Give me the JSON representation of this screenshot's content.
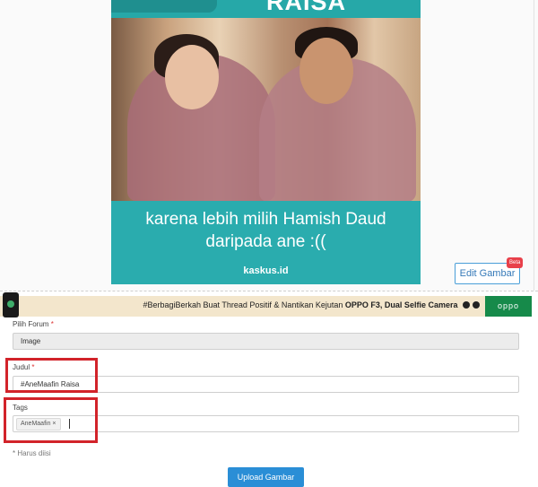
{
  "meme": {
    "title": "RAISA",
    "caption_line1": "karena lebih milih Hamish Daud",
    "caption_line2": "daripada ane :((",
    "brand": "kaskus.id"
  },
  "edit_image": {
    "label": "Edit Gambar",
    "badge": "Beta"
  },
  "banner": {
    "text": "#BerbagiBerkah Buat Thread Positif & Nantikan Kejutan ",
    "text_bold": "OPPO F3, Dual Selfie Camera",
    "logo": "oppo"
  },
  "form": {
    "forum_label": "Pilih Forum",
    "forum_value": "Image",
    "title_label": "Judul",
    "title_value": "#AneMaafin Raisa",
    "tags_label": "Tags",
    "tag_value": "AneMaafin",
    "tag_remove": "×",
    "required_asterisk": "*",
    "required_note": "* Harus diisi",
    "upload_label": "Upload Gambar"
  },
  "colors": {
    "teal": "#2aacae",
    "accent_red": "#d2232a",
    "button_blue": "#2a8ed6"
  }
}
